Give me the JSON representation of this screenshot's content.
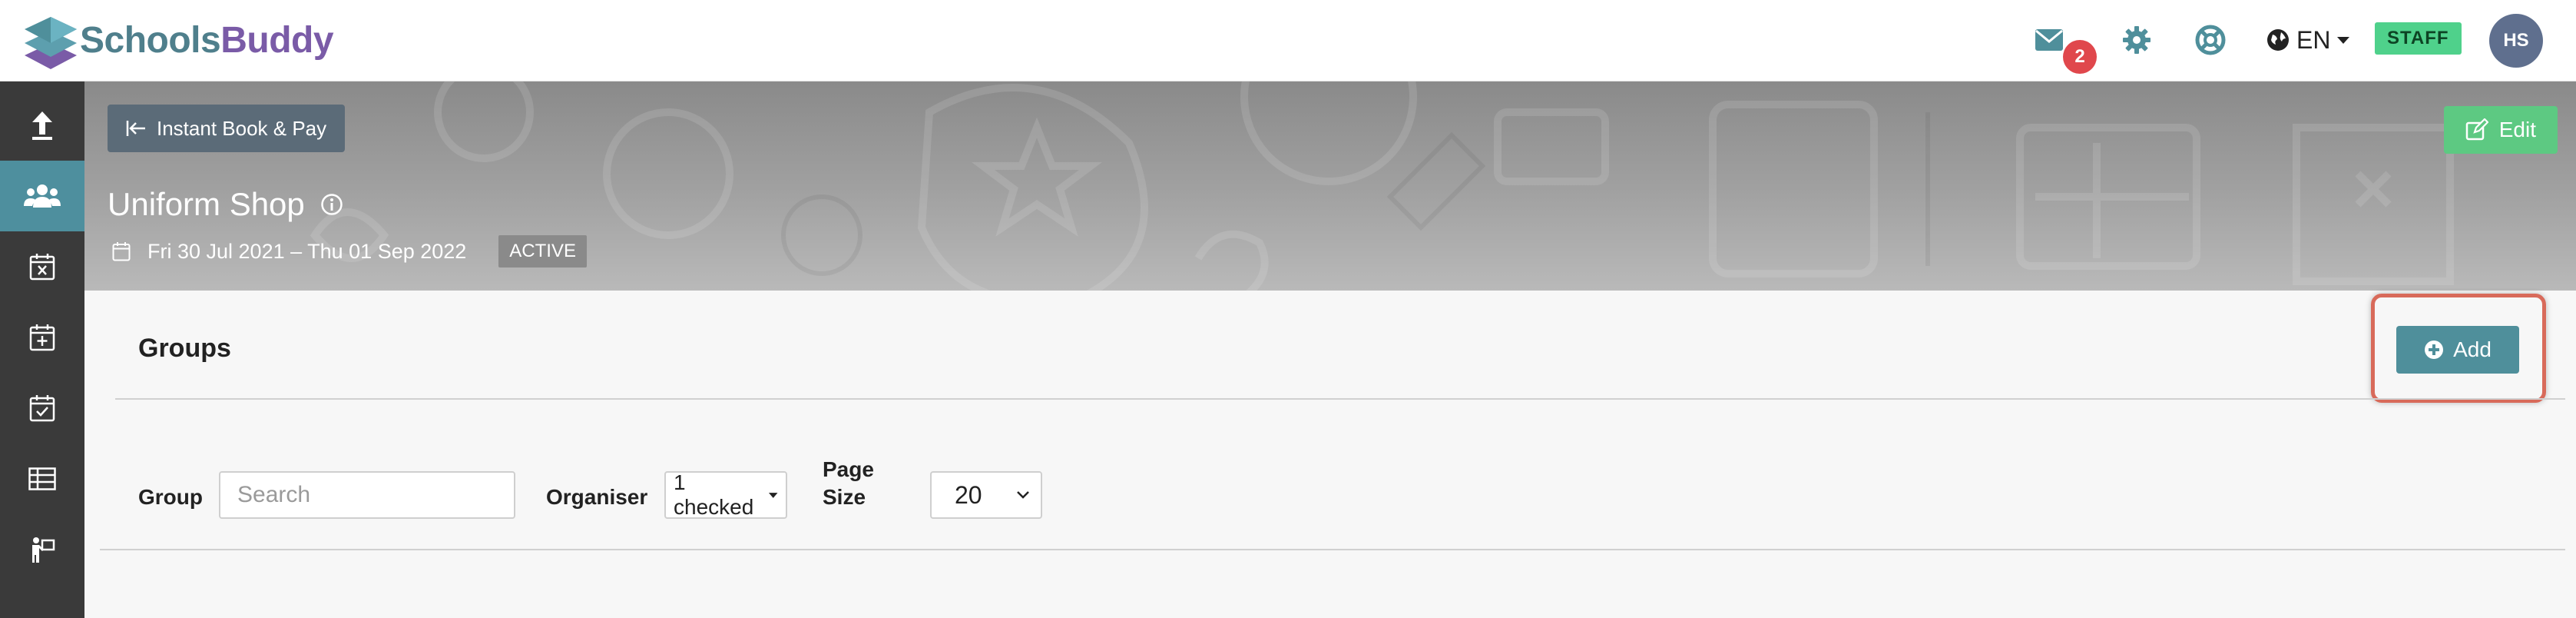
{
  "navbar": {
    "logo": {
      "part1": "Schools",
      "part2": "Buddy"
    },
    "messages_icon": "envelope-icon",
    "messages_count": "2",
    "settings_icon": "gear-icon",
    "help_icon": "lifebuoy-icon",
    "language": "EN",
    "role_badge": "STAFF",
    "avatar_initials": "HS"
  },
  "sidebar": {
    "items": [
      {
        "icon": "upload-arrow-icon",
        "active": false
      },
      {
        "icon": "users-icon",
        "active": true
      },
      {
        "icon": "calendar-x-icon",
        "active": false
      },
      {
        "icon": "calendar-plus-icon",
        "active": false
      },
      {
        "icon": "calendar-check-icon",
        "active": false
      },
      {
        "icon": "table-icon",
        "active": false
      },
      {
        "icon": "person-board-icon",
        "active": false
      }
    ]
  },
  "header": {
    "back_button_label": "Instant Book & Pay",
    "edit_button_label": "Edit",
    "title": "Uniform Shop",
    "date_range": "Fri 30 Jul 2021 – Thu 01 Sep 2022",
    "status": "ACTIVE"
  },
  "main": {
    "section_title": "Groups",
    "add_button_label": "Add",
    "filters": {
      "group_label": "Group",
      "search_placeholder": "Search",
      "organiser_label": "Organiser",
      "organiser_value": "1 checked",
      "page_size_label_line1": "Page",
      "page_size_label_line2": "Size",
      "page_size_value": "20"
    }
  },
  "colors": {
    "brand_teal": "#4f8f9b",
    "brand_purple": "#7a5ba7",
    "sidebar_bg": "#3a3a3a",
    "staff_green": "#4fd18b",
    "edit_green": "#5dc982",
    "badge_red": "#e0474c",
    "highlight_red": "#d86a5a"
  }
}
